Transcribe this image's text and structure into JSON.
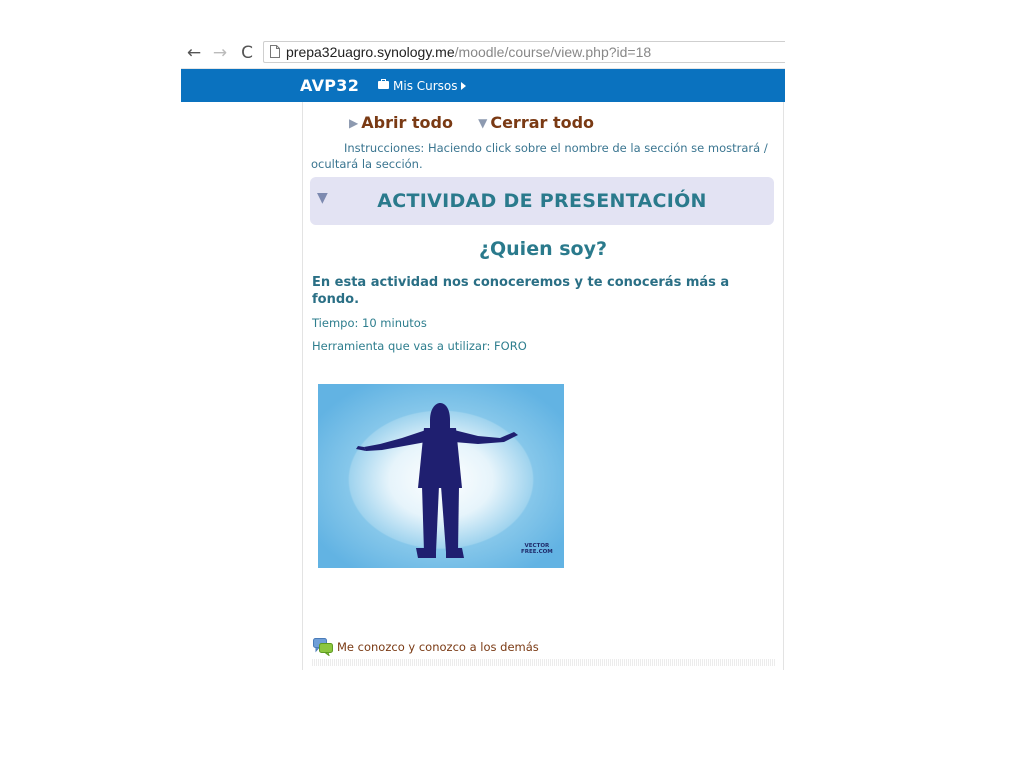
{
  "browser": {
    "url_host": "prepa32uagro.synology.me",
    "url_path": "/moodle/course/view.php?id=18",
    "back_glyph": "←",
    "forward_glyph": "→",
    "reload_glyph": "C"
  },
  "navbar": {
    "brand": "AVP32",
    "menu_label": "Mis Cursos",
    "color": "#0a72bf"
  },
  "toggles": {
    "expand_all": "Abrir todo",
    "collapse_all": "Cerrar todo",
    "instructions": "Instrucciones: Haciendo click sobre el nombre de la sección se mostrará / ocultará la sección."
  },
  "section": {
    "title": "ACTIVIDAD DE PRESENTACIÓN",
    "activity_title": "¿Quien soy?",
    "description": "En esta actividad nos conoceremos y te conocerás más a fondo.",
    "time": "Tiempo: 10 minutos",
    "tool": "Herramienta que vas a utilizar: FORO",
    "image_credit_line1": "VECTOR",
    "image_credit_line2": "FREE.COM"
  },
  "forum": {
    "label": "Me conozco y conozco a los demás",
    "icon": "forum-icon"
  },
  "colors": {
    "link": "#7a3a14",
    "heading": "#2a7a8c",
    "section_bg": "#e3e3f3"
  }
}
